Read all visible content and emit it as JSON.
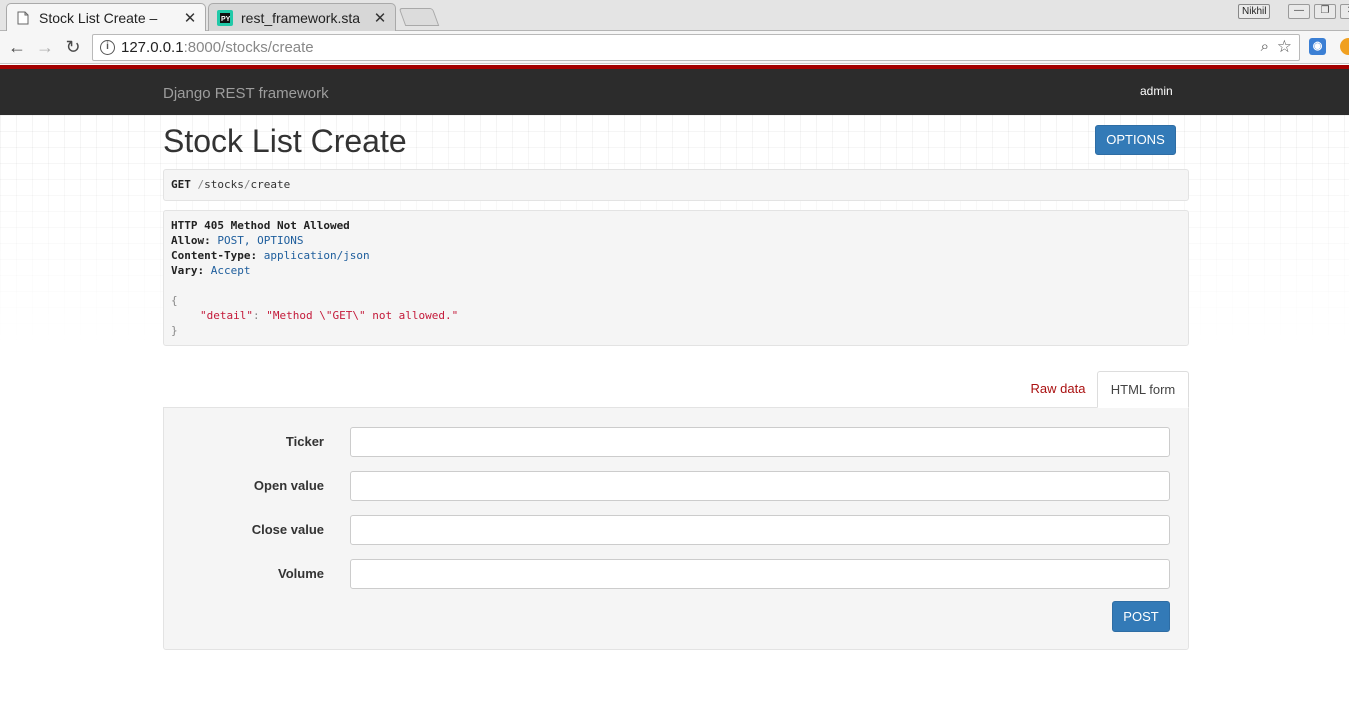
{
  "browser": {
    "tabs": [
      {
        "title": "Stock List Create –",
        "active": true,
        "icon": "page-icon"
      },
      {
        "title": "rest_framework.sta",
        "active": false,
        "icon": "pycharm-icon"
      }
    ],
    "user_badge": "Nikhil",
    "url_host": "127.0.0.1",
    "url_rest": ":8000/stocks/create",
    "window_controls": [
      "—",
      "❐",
      "✕"
    ]
  },
  "navbar": {
    "brand": "Django REST framework",
    "user": "admin"
  },
  "page": {
    "title": "Stock List Create",
    "options_label": "OPTIONS"
  },
  "request": {
    "method": "GET",
    "path_parts": [
      "stocks",
      "create"
    ]
  },
  "response": {
    "status_line": "HTTP 405 Method Not Allowed",
    "headers": [
      {
        "name": "Allow:",
        "value": "POST, OPTIONS"
      },
      {
        "name": "Content-Type:",
        "value": "application/json"
      },
      {
        "name": "Vary:",
        "value": "Accept"
      }
    ],
    "body_open": "{",
    "body_key": "\"detail\"",
    "body_colon": ":",
    "body_value": "\"Method \\\"GET\\\" not allowed.\"",
    "body_close": "}"
  },
  "form_tabs": {
    "raw": "Raw data",
    "html": "HTML form"
  },
  "form": {
    "fields": [
      {
        "label": "Ticker",
        "value": ""
      },
      {
        "label": "Open value",
        "value": ""
      },
      {
        "label": "Close value",
        "value": ""
      },
      {
        "label": "Volume",
        "value": ""
      }
    ],
    "submit_label": "POST"
  },
  "colors": {
    "navbar_bg": "#2c2c2c",
    "accent_red": "#a30000",
    "primary_button": "#337ab7",
    "header_value": "#1d5d9c",
    "json_string": "#c41a3a"
  }
}
